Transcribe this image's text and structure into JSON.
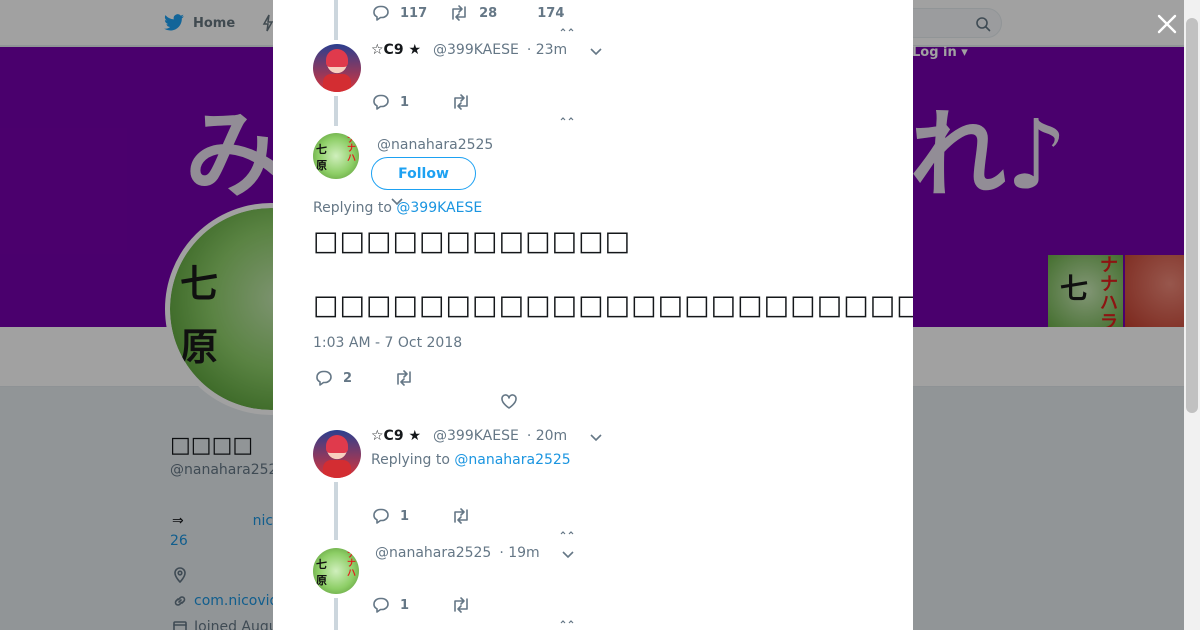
{
  "background": {
    "nav": {
      "home_label": "Home",
      "login_label": "Log in"
    },
    "banner_text_left": "み",
    "banner_text_right": "れ♪",
    "profile": {
      "name": "□□□□",
      "handle": "@nanahara252",
      "bio_arrow": "⇒",
      "bio_link": "nico",
      "bio_number": "26",
      "url": "com.nicovid",
      "joined": "Joined Augu"
    }
  },
  "modal": {
    "top_tweet": {
      "replies": "117",
      "retweets": "28",
      "likes": "174"
    },
    "tweet1": {
      "name": "☆C9 ★",
      "handle": "@399KAESE",
      "time": "· 23m",
      "replies": "1"
    },
    "main_tweet": {
      "handle": "@nanahara2525",
      "follow_label": "Follow",
      "replying_prefix": "Replying to ",
      "replying_handle": "@399KAESE",
      "text_line1": "□□□□□□□□□□□□",
      "text_line2": "□□□□□□□□□□□□□□□□□□□□□□□□□□□□□□□□",
      "timestamp": "1:03 AM - 7 Oct 2018",
      "replies": "2"
    },
    "tweet2": {
      "name": "☆C9 ★",
      "handle": "@399KAESE",
      "time": "· 20m",
      "replying_prefix": "Replying to ",
      "replying_handle": "@nanahara2525",
      "replies": "1"
    },
    "tweet3": {
      "handle": "@nanahara2525",
      "time": "· 19m",
      "replies": "1"
    }
  },
  "colors": {
    "brand": "#1da1f2",
    "banner": "#7600ad",
    "link": "#1b95e0"
  },
  "icons": [
    "twitter-bird-icon",
    "search-icon",
    "close-icon",
    "reply-icon",
    "retweet-icon",
    "like-icon",
    "chevron-down-icon",
    "location-icon",
    "link-icon",
    "calendar-icon"
  ]
}
